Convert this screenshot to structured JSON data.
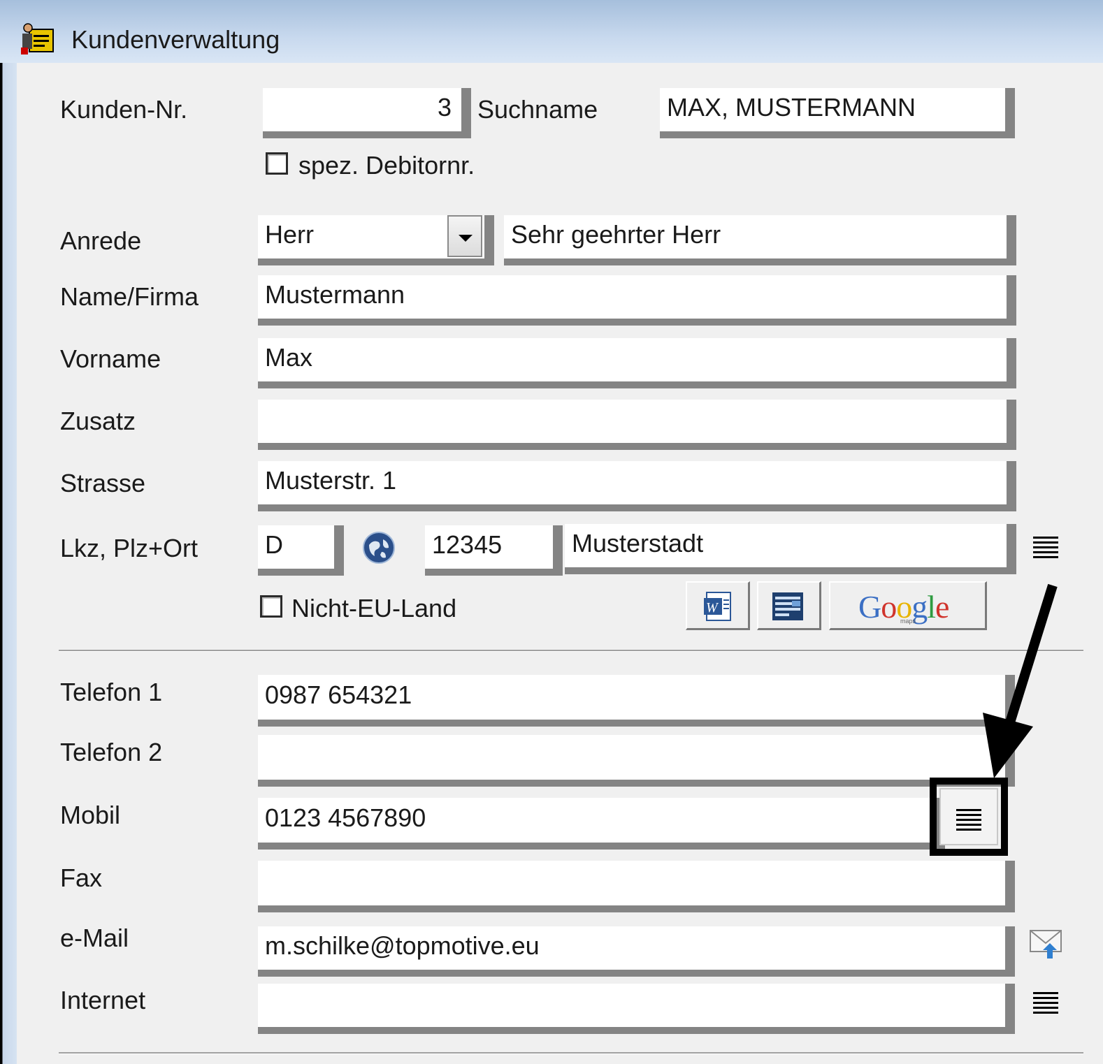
{
  "window": {
    "title": "Kundenverwaltung"
  },
  "form": {
    "kundennr": {
      "label": "Kunden-Nr.",
      "value": "3"
    },
    "suchname": {
      "label": "Suchname",
      "value": "MAX, MUSTERMANN"
    },
    "spez_debitor": {
      "label": "spez. Debitornr.",
      "checked": false
    },
    "anrede": {
      "label": "Anrede",
      "value": "Herr",
      "greeting": "Sehr geehrter Herr"
    },
    "name": {
      "label": "Name/Firma",
      "value": "Mustermann"
    },
    "vorname": {
      "label": "Vorname",
      "value": "Max"
    },
    "zusatz": {
      "label": "Zusatz",
      "value": ""
    },
    "strasse": {
      "label": "Strasse",
      "value": "Musterstr. 1"
    },
    "ort": {
      "label": "Lkz, Plz+Ort",
      "lkz": "D",
      "plz": "12345",
      "ort": "Musterstadt"
    },
    "nicht_eu": {
      "label": "Nicht-EU-Land",
      "checked": false
    },
    "telefon1": {
      "label": "Telefon 1",
      "value": "0987 654321"
    },
    "telefon2": {
      "label": "Telefon 2",
      "value": ""
    },
    "mobil": {
      "label": "Mobil",
      "value": "0123 4567890"
    },
    "fax": {
      "label": "Fax",
      "value": ""
    },
    "email": {
      "label": "e-Mail",
      "value": "m.schilke@topmotive.eu"
    },
    "internet": {
      "label": "Internet",
      "value": ""
    }
  },
  "toolbar": {
    "word_icon": "word-icon",
    "table_icon": "table-icon",
    "google_label": "Google",
    "google_sub": "maps"
  }
}
